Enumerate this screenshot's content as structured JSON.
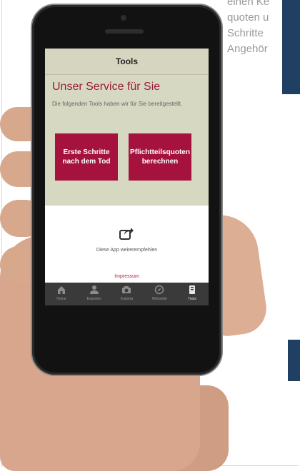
{
  "page": {
    "side_text": [
      "einen Ke",
      "quoten u",
      "Schritte",
      "Angehör"
    ]
  },
  "app": {
    "header_title": "Tools",
    "heading": "Unser Service für Sie",
    "subtitle": "Die folgenden Tools haben wir für Sie bereitgestellt.",
    "buttons": [
      {
        "label": "Erste Schritte nach dem Tod"
      },
      {
        "label": "Pflichtteilsquoten berechnen"
      }
    ],
    "share_label": "Diese App weiterempfehlen",
    "impressum": "Impressum",
    "tabs": [
      {
        "label": "Home",
        "icon": "home-icon",
        "active": false
      },
      {
        "label": "Experten",
        "icon": "person-icon",
        "active": false
      },
      {
        "label": "Kamera",
        "icon": "camera-icon",
        "active": false
      },
      {
        "label": "Webseite",
        "icon": "compass-icon",
        "active": false
      },
      {
        "label": "Tools",
        "icon": "tools-icon",
        "active": true
      }
    ],
    "colors": {
      "accent": "#a5123e",
      "header_bg": "#d6d6c0",
      "tabbar_bg": "#3a3a3a"
    }
  }
}
